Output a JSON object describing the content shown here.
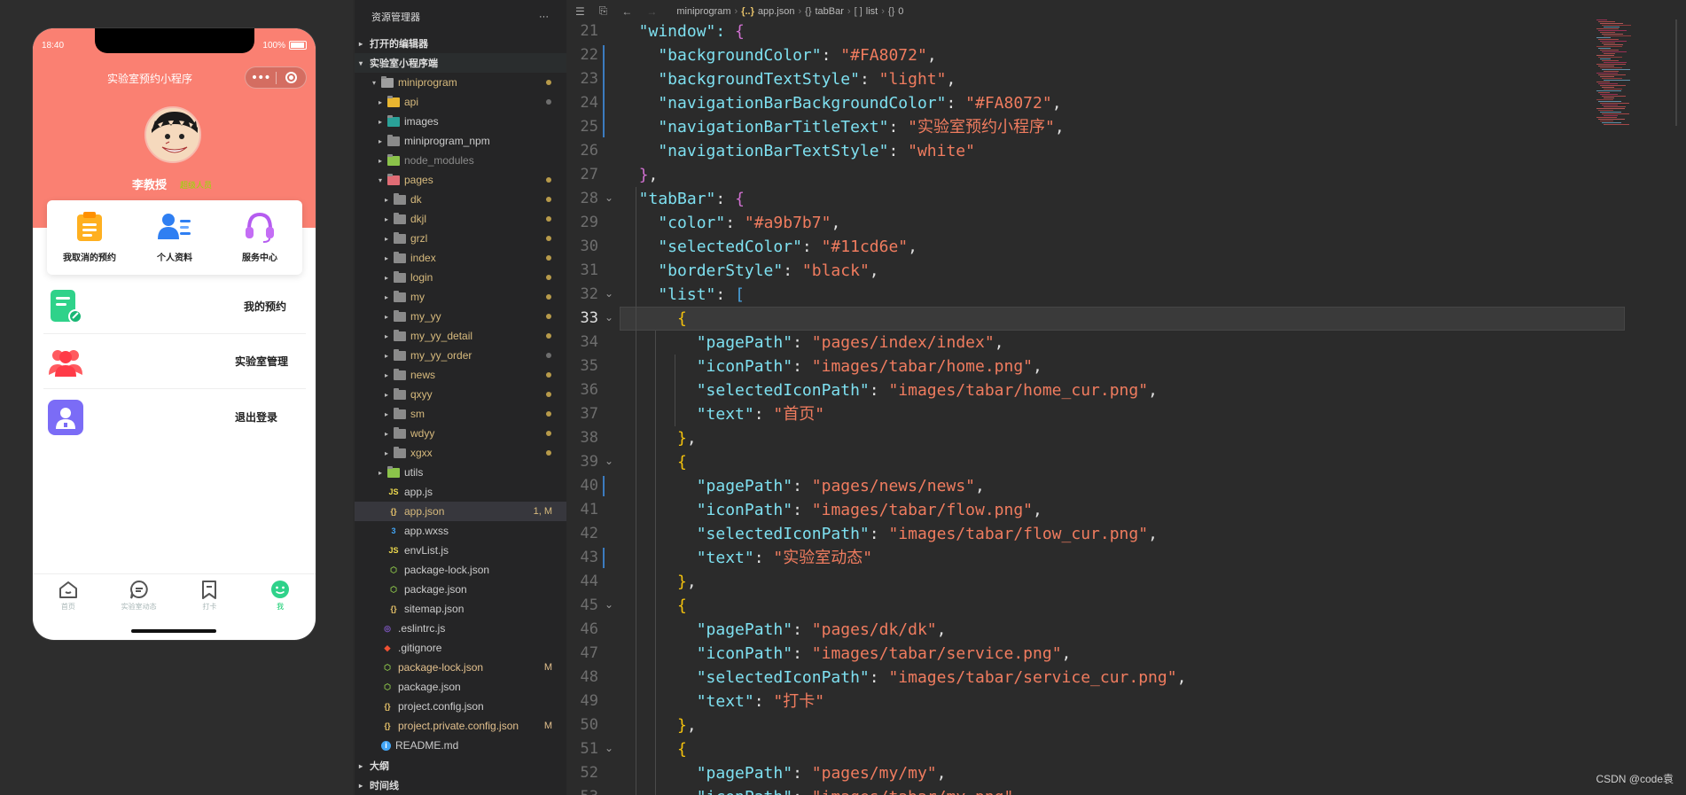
{
  "simulator": {
    "status_time": "18:40",
    "status_battery": "100%",
    "nav_title": "实验室预约小程序",
    "capsule_menu": "•••",
    "user_name": "李教授",
    "user_role": "超级人员",
    "quick_actions": [
      {
        "label": "我取消的预约",
        "icon": "clipboard-icon"
      },
      {
        "label": "个人资料",
        "icon": "profile-card-icon"
      },
      {
        "label": "服务中心",
        "icon": "headset-icon"
      }
    ],
    "menu_items": [
      {
        "label": "我的预约",
        "icon": "note-edit-icon"
      },
      {
        "label": "实验室管理",
        "icon": "users-group-icon"
      },
      {
        "label": "退出登录",
        "icon": "user-badge-icon"
      }
    ],
    "tabs": [
      {
        "label": "首页",
        "icon": "home-icon"
      },
      {
        "label": "实验室动态",
        "icon": "chat-icon"
      },
      {
        "label": "打卡",
        "icon": "bookmark-icon"
      },
      {
        "label": "我",
        "icon": "smiley-icon"
      }
    ],
    "colors": {
      "nav_bg": "#FA8072",
      "tab_color": "#a9b7b7",
      "tab_selected": "#11cd6e"
    }
  },
  "explorer": {
    "title": "资源管理器",
    "more": "···",
    "open_editors": "打开的编辑器",
    "project": "实验室小程序端",
    "rows": [
      {
        "label": "miniprogram",
        "type": "folder-open",
        "depth": 1,
        "color": "yellow",
        "dot": "yellow",
        "arrow": "▾"
      },
      {
        "label": "api",
        "type": "folder-api",
        "depth": 2,
        "color": "yellow",
        "dot": "grey",
        "arrow": "▸"
      },
      {
        "label": "images",
        "type": "folder-img",
        "depth": 2,
        "color": "def",
        "arrow": "▸"
      },
      {
        "label": "miniprogram_npm",
        "type": "folder",
        "depth": 2,
        "color": "def",
        "arrow": "▸"
      },
      {
        "label": "node_modules",
        "type": "folder-node",
        "depth": 2,
        "color": "grey",
        "arrow": "▸"
      },
      {
        "label": "pages",
        "type": "folder-pages",
        "depth": 2,
        "color": "yellow",
        "dot": "yellow",
        "arrow": "▾"
      },
      {
        "label": "dk",
        "type": "folder",
        "depth": 3,
        "color": "yellow",
        "dot": "yellow",
        "arrow": "▸"
      },
      {
        "label": "dkjl",
        "type": "folder",
        "depth": 3,
        "color": "yellow",
        "dot": "yellow",
        "arrow": "▸"
      },
      {
        "label": "grzl",
        "type": "folder",
        "depth": 3,
        "color": "yellow",
        "dot": "yellow",
        "arrow": "▸"
      },
      {
        "label": "index",
        "type": "folder",
        "depth": 3,
        "color": "yellow",
        "dot": "yellow",
        "arrow": "▸"
      },
      {
        "label": "login",
        "type": "folder",
        "depth": 3,
        "color": "yellow",
        "dot": "yellow",
        "arrow": "▸"
      },
      {
        "label": "my",
        "type": "folder",
        "depth": 3,
        "color": "yellow",
        "dot": "yellow",
        "arrow": "▸"
      },
      {
        "label": "my_yy",
        "type": "folder",
        "depth": 3,
        "color": "yellow",
        "dot": "yellow",
        "arrow": "▸"
      },
      {
        "label": "my_yy_detail",
        "type": "folder",
        "depth": 3,
        "color": "yellow",
        "dot": "yellow",
        "arrow": "▸"
      },
      {
        "label": "my_yy_order",
        "type": "folder",
        "depth": 3,
        "color": "yellow",
        "dot": "grey",
        "arrow": "▸"
      },
      {
        "label": "news",
        "type": "folder",
        "depth": 3,
        "color": "yellow",
        "dot": "yellow",
        "arrow": "▸"
      },
      {
        "label": "qxyy",
        "type": "folder",
        "depth": 3,
        "color": "yellow",
        "dot": "yellow",
        "arrow": "▸"
      },
      {
        "label": "sm",
        "type": "folder",
        "depth": 3,
        "color": "yellow",
        "dot": "yellow",
        "arrow": "▸"
      },
      {
        "label": "wdyy",
        "type": "folder",
        "depth": 3,
        "color": "yellow",
        "dot": "yellow",
        "arrow": "▸"
      },
      {
        "label": "xgxx",
        "type": "folder",
        "depth": 3,
        "color": "yellow",
        "dot": "yellow",
        "arrow": "▸"
      },
      {
        "label": "utils",
        "type": "folder-utils",
        "depth": 2,
        "color": "def",
        "arrow": "▸"
      },
      {
        "label": "app.js",
        "type": "js",
        "depth": 2,
        "color": "def"
      },
      {
        "label": "app.json",
        "type": "json",
        "depth": 2,
        "color": "yellow",
        "status": "1, M",
        "selected": true
      },
      {
        "label": "app.wxss",
        "type": "css",
        "depth": 2,
        "color": "def"
      },
      {
        "label": "envList.js",
        "type": "js",
        "depth": 2,
        "color": "def"
      },
      {
        "label": "package-lock.json",
        "type": "npm",
        "depth": 2,
        "color": "def"
      },
      {
        "label": "package.json",
        "type": "npm",
        "depth": 2,
        "color": "def"
      },
      {
        "label": "sitemap.json",
        "type": "json",
        "depth": 2,
        "color": "def"
      },
      {
        "label": ".eslintrc.js",
        "type": "eslint",
        "depth": 1,
        "color": "def"
      },
      {
        "label": ".gitignore",
        "type": "git",
        "depth": 1,
        "color": "def"
      },
      {
        "label": "package-lock.json",
        "type": "npm",
        "depth": 1,
        "color": "mod",
        "status": "M"
      },
      {
        "label": "package.json",
        "type": "npm",
        "depth": 1,
        "color": "def"
      },
      {
        "label": "project.config.json",
        "type": "json",
        "depth": 1,
        "color": "def"
      },
      {
        "label": "project.private.config.json",
        "type": "json",
        "depth": 1,
        "color": "mod",
        "status": "M"
      },
      {
        "label": "README.md",
        "type": "info",
        "depth": 1,
        "color": "def"
      }
    ],
    "outline": "大纲",
    "timeline": "时间线"
  },
  "breadcrumb": {
    "folder": "miniprogram",
    "file": "app.json",
    "obj": "tabBar",
    "arr": "list",
    "idx": "0"
  },
  "editor": {
    "first_line": 21,
    "current_line": 33,
    "lines": [
      [
        {
          "t": "  \"window\": ",
          "c": "k"
        },
        {
          "t": "{",
          "c": "b2"
        }
      ],
      [
        {
          "t": "    \"backgroundColor\"",
          "c": "k"
        },
        {
          "t": ": ",
          "c": "p"
        },
        {
          "t": "\"#FA8072\"",
          "c": "s"
        },
        {
          "t": ",",
          "c": "p"
        }
      ],
      [
        {
          "t": "    \"backgroundTextStyle\"",
          "c": "k"
        },
        {
          "t": ": ",
          "c": "p"
        },
        {
          "t": "\"light\"",
          "c": "s"
        },
        {
          "t": ",",
          "c": "p"
        }
      ],
      [
        {
          "t": "    \"navigationBarBackgroundColor\"",
          "c": "k"
        },
        {
          "t": ": ",
          "c": "p"
        },
        {
          "t": "\"#FA8072\"",
          "c": "s"
        },
        {
          "t": ",",
          "c": "p"
        }
      ],
      [
        {
          "t": "    \"navigationBarTitleText\"",
          "c": "k"
        },
        {
          "t": ": ",
          "c": "p"
        },
        {
          "t": "\"实验室预约小程序\"",
          "c": "s"
        },
        {
          "t": ",",
          "c": "p"
        }
      ],
      [
        {
          "t": "    \"navigationBarTextStyle\"",
          "c": "k"
        },
        {
          "t": ": ",
          "c": "p"
        },
        {
          "t": "\"white\"",
          "c": "s"
        }
      ],
      [
        {
          "t": "  ",
          "c": "p"
        },
        {
          "t": "}",
          "c": "b2"
        },
        {
          "t": ",",
          "c": "p"
        }
      ],
      [
        {
          "t": "  \"tabBar\"",
          "c": "k"
        },
        {
          "t": ": ",
          "c": "p"
        },
        {
          "t": "{",
          "c": "b2"
        }
      ],
      [
        {
          "t": "    \"color\"",
          "c": "k"
        },
        {
          "t": ": ",
          "c": "p"
        },
        {
          "t": "\"#a9b7b7\"",
          "c": "s"
        },
        {
          "t": ",",
          "c": "p"
        }
      ],
      [
        {
          "t": "    \"selectedColor\"",
          "c": "k"
        },
        {
          "t": ": ",
          "c": "p"
        },
        {
          "t": "\"#11cd6e\"",
          "c": "s"
        },
        {
          "t": ",",
          "c": "p"
        }
      ],
      [
        {
          "t": "    \"borderStyle\"",
          "c": "k"
        },
        {
          "t": ": ",
          "c": "p"
        },
        {
          "t": "\"black\"",
          "c": "s"
        },
        {
          "t": ",",
          "c": "p"
        }
      ],
      [
        {
          "t": "    \"list\"",
          "c": "k"
        },
        {
          "t": ": ",
          "c": "p"
        },
        {
          "t": "[",
          "c": "b3"
        }
      ],
      [
        {
          "t": "      ",
          "c": "p"
        },
        {
          "t": "{",
          "c": "b1"
        }
      ],
      [
        {
          "t": "        \"pagePath\"",
          "c": "k"
        },
        {
          "t": ": ",
          "c": "p"
        },
        {
          "t": "\"pages/index/index\"",
          "c": "s"
        },
        {
          "t": ",",
          "c": "p"
        }
      ],
      [
        {
          "t": "        \"iconPath\"",
          "c": "k"
        },
        {
          "t": ": ",
          "c": "p"
        },
        {
          "t": "\"images/tabar/home.png\"",
          "c": "s"
        },
        {
          "t": ",",
          "c": "p"
        }
      ],
      [
        {
          "t": "        \"selectedIconPath\"",
          "c": "k"
        },
        {
          "t": ": ",
          "c": "p"
        },
        {
          "t": "\"images/tabar/home_cur.png\"",
          "c": "s"
        },
        {
          "t": ",",
          "c": "p"
        }
      ],
      [
        {
          "t": "        \"text\"",
          "c": "k"
        },
        {
          "t": ": ",
          "c": "p"
        },
        {
          "t": "\"首页\"",
          "c": "s"
        }
      ],
      [
        {
          "t": "      ",
          "c": "p"
        },
        {
          "t": "}",
          "c": "b1"
        },
        {
          "t": ",",
          "c": "p"
        }
      ],
      [
        {
          "t": "      ",
          "c": "p"
        },
        {
          "t": "{",
          "c": "b1"
        }
      ],
      [
        {
          "t": "        \"pagePath\"",
          "c": "k"
        },
        {
          "t": ": ",
          "c": "p"
        },
        {
          "t": "\"pages/news/news\"",
          "c": "s"
        },
        {
          "t": ",",
          "c": "p"
        }
      ],
      [
        {
          "t": "        \"iconPath\"",
          "c": "k"
        },
        {
          "t": ": ",
          "c": "p"
        },
        {
          "t": "\"images/tabar/flow.png\"",
          "c": "s"
        },
        {
          "t": ",",
          "c": "p"
        }
      ],
      [
        {
          "t": "        \"selectedIconPath\"",
          "c": "k"
        },
        {
          "t": ": ",
          "c": "p"
        },
        {
          "t": "\"images/tabar/flow_cur.png\"",
          "c": "s"
        },
        {
          "t": ",",
          "c": "p"
        }
      ],
      [
        {
          "t": "        \"text\"",
          "c": "k"
        },
        {
          "t": ": ",
          "c": "p"
        },
        {
          "t": "\"实验室动态\"",
          "c": "s"
        }
      ],
      [
        {
          "t": "      ",
          "c": "p"
        },
        {
          "t": "}",
          "c": "b1"
        },
        {
          "t": ",",
          "c": "p"
        }
      ],
      [
        {
          "t": "      ",
          "c": "p"
        },
        {
          "t": "{",
          "c": "b1"
        }
      ],
      [
        {
          "t": "        \"pagePath\"",
          "c": "k"
        },
        {
          "t": ": ",
          "c": "p"
        },
        {
          "t": "\"pages/dk/dk\"",
          "c": "s"
        },
        {
          "t": ",",
          "c": "p"
        }
      ],
      [
        {
          "t": "        \"iconPath\"",
          "c": "k"
        },
        {
          "t": ": ",
          "c": "p"
        },
        {
          "t": "\"images/tabar/service.png\"",
          "c": "s"
        },
        {
          "t": ",",
          "c": "p"
        }
      ],
      [
        {
          "t": "        \"selectedIconPath\"",
          "c": "k"
        },
        {
          "t": ": ",
          "c": "p"
        },
        {
          "t": "\"images/tabar/service_cur.png\"",
          "c": "s"
        },
        {
          "t": ",",
          "c": "p"
        }
      ],
      [
        {
          "t": "        \"text\"",
          "c": "k"
        },
        {
          "t": ": ",
          "c": "p"
        },
        {
          "t": "\"打卡\"",
          "c": "s"
        }
      ],
      [
        {
          "t": "      ",
          "c": "p"
        },
        {
          "t": "}",
          "c": "b1"
        },
        {
          "t": ",",
          "c": "p"
        }
      ],
      [
        {
          "t": "      ",
          "c": "p"
        },
        {
          "t": "{",
          "c": "b1"
        }
      ],
      [
        {
          "t": "        \"pagePath\"",
          "c": "k"
        },
        {
          "t": ": ",
          "c": "p"
        },
        {
          "t": "\"pages/my/my\"",
          "c": "s"
        },
        {
          "t": ",",
          "c": "p"
        }
      ],
      [
        {
          "t": "        \"iconPath\"",
          "c": "k"
        },
        {
          "t": ": ",
          "c": "p"
        },
        {
          "t": "\"images/tabar/my.png\"",
          "c": "s"
        },
        {
          "t": ",",
          "c": "p"
        }
      ]
    ],
    "fold_lines": [
      28,
      32,
      33,
      39,
      45,
      51
    ]
  },
  "watermark": "CSDN @code袁"
}
